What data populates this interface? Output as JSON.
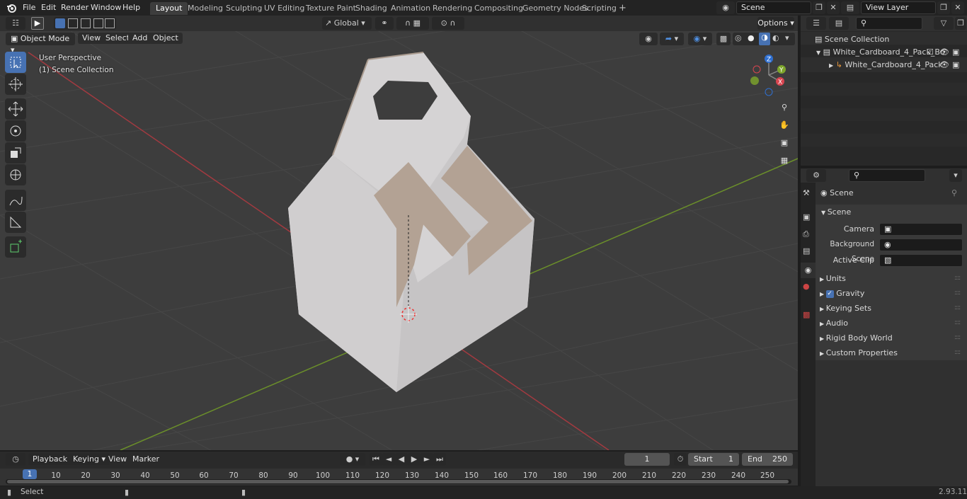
{
  "topbar": {
    "menus": [
      "File",
      "Edit",
      "Render",
      "Window",
      "Help"
    ],
    "workspaces": [
      "Layout",
      "Modeling",
      "Sculpting",
      "UV Editing",
      "Texture Paint",
      "Shading",
      "Animation",
      "Rendering",
      "Compositing",
      "Geometry Nodes",
      "Scripting"
    ],
    "active_workspace": "Layout",
    "add_tab": "+",
    "scene_name": "Scene",
    "view_layer_name": "View Layer"
  },
  "viewport": {
    "transform_orientation": "Global",
    "options_label": "Options",
    "mode": "Object Mode",
    "menus": [
      "View",
      "Select",
      "Add",
      "Object"
    ],
    "overlay_title": "User Perspective",
    "overlay_collection": "(1) Scene Collection",
    "gizmo_axes": {
      "z": "Z",
      "y": "Y",
      "x": "X"
    }
  },
  "outliner": {
    "root": "Scene Collection",
    "items": [
      {
        "label": "White_Cardboard_4_Pack_Bo"
      },
      {
        "label": "White_Cardboard_4_Pack"
      }
    ]
  },
  "properties": {
    "context": "Scene",
    "panel": "Scene",
    "fields": [
      {
        "label": "Camera",
        "value": ""
      },
      {
        "label": "Background Scene",
        "value": ""
      },
      {
        "label": "Active Clip",
        "value": ""
      }
    ],
    "sections": [
      {
        "label": "Units"
      },
      {
        "label": "Gravity",
        "checked": true
      },
      {
        "label": "Keying Sets"
      },
      {
        "label": "Audio"
      },
      {
        "label": "Rigid Body World"
      },
      {
        "label": "Custom Properties"
      }
    ]
  },
  "timeline": {
    "menus": [
      "Playback",
      "Keying",
      "View",
      "Marker"
    ],
    "current_frame": "1",
    "start_label": "Start",
    "start_value": "1",
    "end_label": "End",
    "end_value": "250",
    "ticks": [
      "1",
      "10",
      "20",
      "30",
      "40",
      "50",
      "60",
      "70",
      "80",
      "90",
      "100",
      "110",
      "120",
      "130",
      "140",
      "150",
      "160",
      "170",
      "180",
      "190",
      "200",
      "210",
      "220",
      "230",
      "240",
      "250"
    ]
  },
  "statusbar": {
    "hint": "Select",
    "version": "2.93.11"
  },
  "colors": {
    "accent": "#4772b3",
    "x_axis": "#a33a40",
    "y_axis": "#6b8f2a",
    "frame_marker": "#4772b3"
  }
}
